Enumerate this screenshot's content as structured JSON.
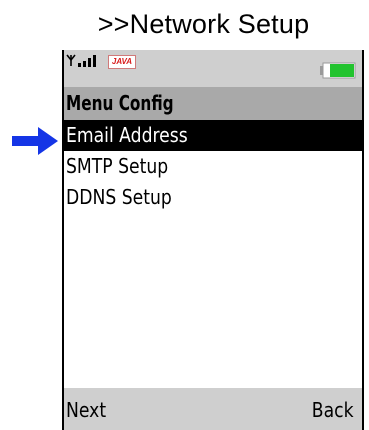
{
  "caption": ">>Network Setup",
  "status_bar": {
    "java_label": "JAVA",
    "signal_icon": "signal-strength-icon",
    "battery_icon": "battery-icon",
    "battery_color": "#22c32e"
  },
  "title": "Menu Config",
  "menu": {
    "items": [
      {
        "label": "Email Address",
        "selected": true
      },
      {
        "label": "SMTP Setup",
        "selected": false
      },
      {
        "label": "DDNS Setup",
        "selected": false
      }
    ]
  },
  "softkeys": {
    "left": "Next",
    "right": "Back"
  },
  "pointer": {
    "icon": "right-arrow-icon",
    "color": "#1535e6"
  }
}
